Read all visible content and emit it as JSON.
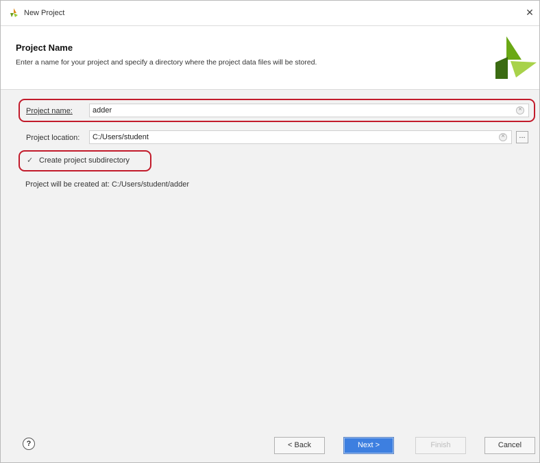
{
  "window": {
    "title": "New Project"
  },
  "header": {
    "title": "Project Name",
    "description": "Enter a name for your project and specify a directory where the project data files will be stored."
  },
  "form": {
    "project_name_label": "Project name:",
    "project_name_value": "adder",
    "project_location_label": "Project location:",
    "project_location_value": "C:/Users/student",
    "browse_label": "...",
    "subdirectory_label": "Create project subdirectory",
    "subdirectory_checked": true,
    "created_at_text": "Project will be created at: C:/Users/student/adder"
  },
  "footer": {
    "help_label": "?",
    "back_label": "< Back",
    "next_label": "Next >",
    "finish_label": "Finish",
    "cancel_label": "Cancel"
  },
  "colors": {
    "highlight": "#c21a2a",
    "primary_button": "#3d7fe0",
    "logo_green": "#7fae1b",
    "logo_dark": "#3b6b12"
  },
  "icons": {
    "app": "vivado-logo-icon",
    "close": "close-icon",
    "clear": "clear-icon",
    "help": "help-icon"
  }
}
